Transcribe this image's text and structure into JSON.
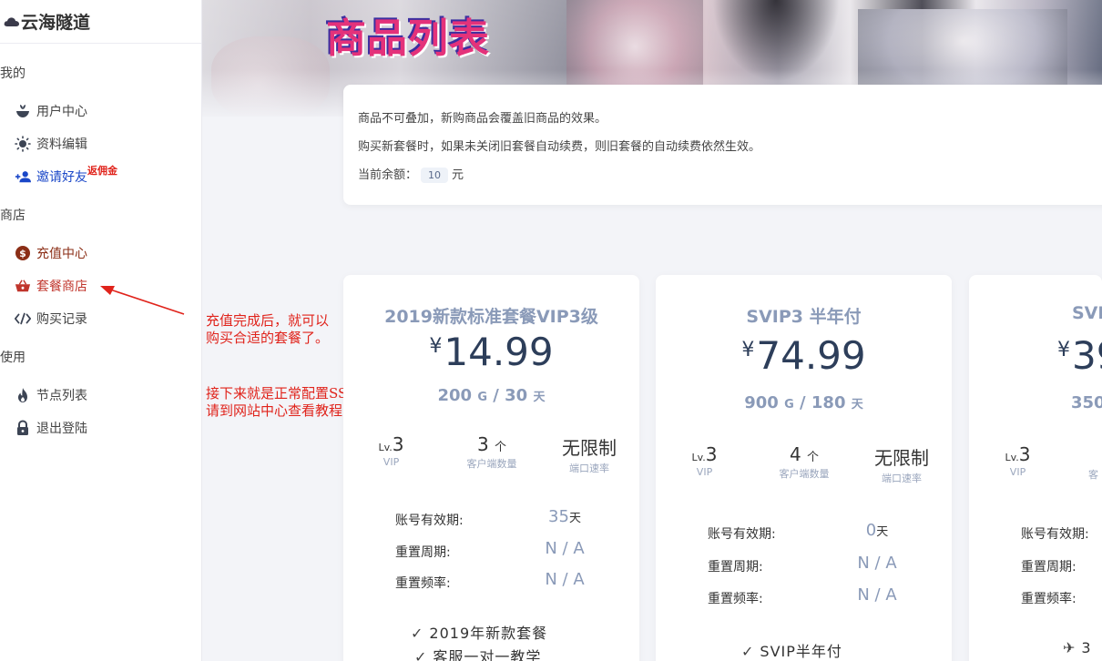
{
  "sidebar": {
    "brand": "云海隧道",
    "sections": {
      "mine": "我的",
      "shop": "商店",
      "use": "使用"
    },
    "items": {
      "user_center": "用户中心",
      "profile_edit": "资料编辑",
      "invite": "邀请好友",
      "invite_badge": "返佣金",
      "recharge": "充值中心",
      "plan_shop": "套餐商店",
      "purchase_history": "购买记录",
      "node_list": "节点列表",
      "logout": "退出登陆"
    }
  },
  "banner": {
    "title": "商品列表"
  },
  "notice": {
    "line1": "商品不可叠加，新购商品会覆盖旧商品的效果。",
    "line2": "购买新套餐时，如果未关闭旧套餐自动续费，则旧套餐的自动续费依然生效。",
    "balance_label": "当前余额：",
    "balance_value": "10",
    "balance_unit": "元"
  },
  "annotations": {
    "a1_line1": "充值完成后，就可以",
    "a1_line2": "购买合适的套餐了。",
    "a2_line1": "接下来就是正常配置SSR软件，",
    "a2_line2": "请到网站中心查看教程"
  },
  "plans": [
    {
      "name": "2019新款标准套餐VIP3级",
      "currency": "¥",
      "price": "14.99",
      "traffic": "200",
      "traffic_unit": "G",
      "sep": "/",
      "days": "30",
      "days_unit": "天",
      "level_prefix": "Lv.",
      "level": "3",
      "level_label": "VIP",
      "clients": "3",
      "clients_unit": "个",
      "clients_label": "客户端数量",
      "speed": "无限制",
      "speed_label": "端口速率",
      "validity_label": "账号有效期:",
      "validity": "35",
      "validity_unit": "天",
      "reset_cycle_label": "重置周期:",
      "reset_cycle": "N / A",
      "reset_freq_label": "重置频率:",
      "reset_freq": "N / A",
      "features": [
        "2019年新款套餐",
        "客服一对一教学"
      ]
    },
    {
      "name": "SVIP3 半年付",
      "currency": "¥",
      "price": "74.99",
      "traffic": "900",
      "traffic_unit": "G",
      "sep": "/",
      "days": "180",
      "days_unit": "天",
      "level_prefix": "Lv.",
      "level": "3",
      "level_label": "VIP",
      "clients": "4",
      "clients_unit": "个",
      "clients_label": "客户端数量",
      "speed": "无限制",
      "speed_label": "端口速率",
      "validity_label": "账号有效期:",
      "validity": "0",
      "validity_unit": "天",
      "reset_cycle_label": "重置周期:",
      "reset_cycle": "N / A",
      "reset_freq_label": "重置频率:",
      "reset_freq": "N / A",
      "features": [
        "SVIP半年付"
      ]
    },
    {
      "name": "SVI",
      "currency": "¥",
      "price": "39",
      "traffic": "350",
      "level_prefix": "Lv.",
      "level": "3",
      "level_label": "VIP",
      "clients_label_partial": "客",
      "validity_label": "账号有效期:",
      "reset_cycle_label": "重置周期:",
      "reset_freq_label": "重置频率:",
      "feature_partial": "3"
    }
  ]
}
